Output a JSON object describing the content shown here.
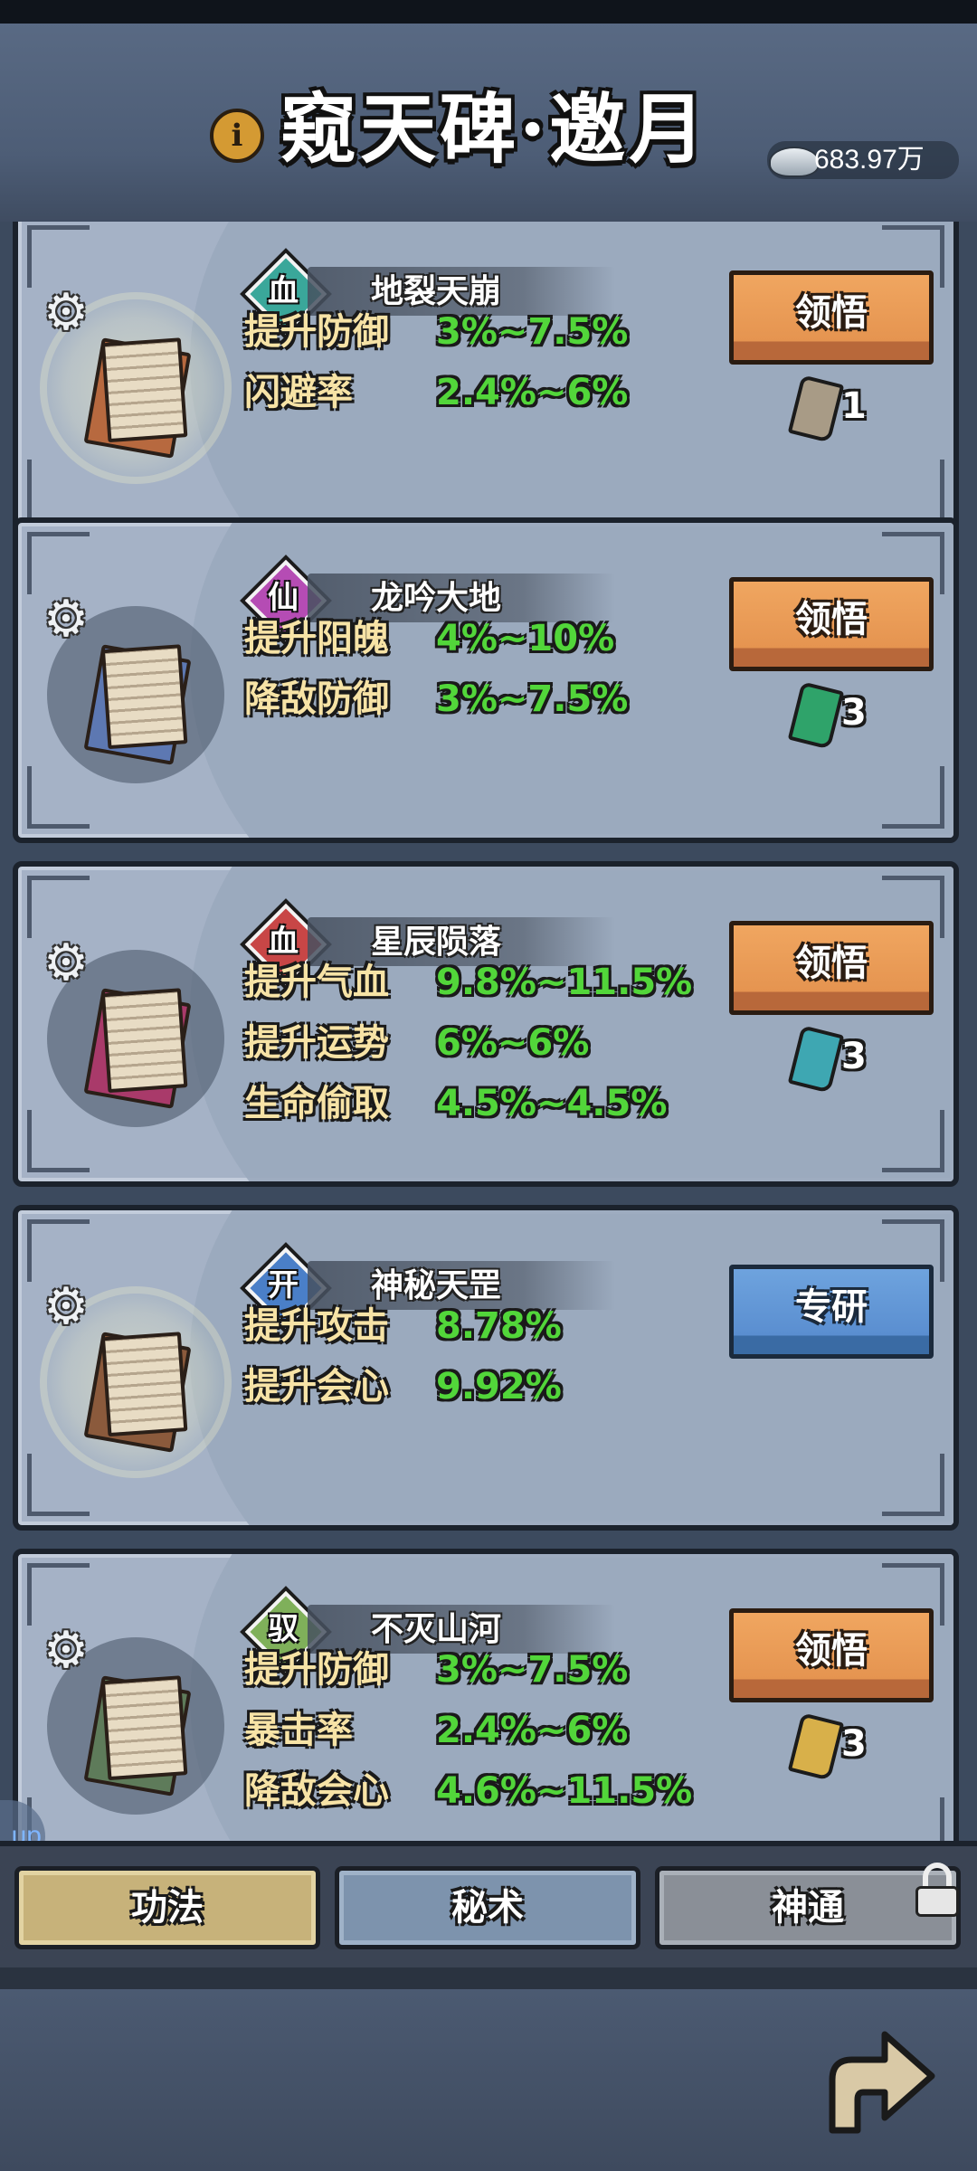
{
  "header": {
    "title": "窥天碑·邀月",
    "info_icon": "info-icon",
    "currency": {
      "icon": "silver-ingot-icon",
      "amount": "683.97万"
    }
  },
  "cards": [
    {
      "grade": "血",
      "grade_color": "#3aa79a",
      "name": "地裂天崩",
      "scroll_color": "#b7693f",
      "glow": true,
      "stats": [
        {
          "name": "提升防御",
          "value": "3%~7.5%"
        },
        {
          "name": "闪避率",
          "value": "2.4%~6%"
        }
      ],
      "button": {
        "label": "领悟",
        "style": "orange"
      },
      "cost": {
        "token_color": "#a89b86",
        "count": "1"
      }
    },
    {
      "grade": "仙",
      "grade_color": "#b54cb4",
      "name": "龙吟大地",
      "scroll_color": "#5d78b2",
      "glow": false,
      "stats": [
        {
          "name": "提升阳魄",
          "value": "4%~10%"
        },
        {
          "name": "降敌防御",
          "value": "3%~7.5%"
        }
      ],
      "button": {
        "label": "领悟",
        "style": "orange"
      },
      "cost": {
        "token_color": "#2fa36a",
        "count": "3"
      }
    },
    {
      "grade": "血",
      "grade_color": "#c84646",
      "name": "星辰陨落",
      "scroll_color": "#a93a6a",
      "glow": false,
      "stats": [
        {
          "name": "提升气血",
          "value": "9.8%~11.5%"
        },
        {
          "name": "提升运势",
          "value": "6%~6%"
        },
        {
          "name": "生命偷取",
          "value": "4.5%~4.5%"
        }
      ],
      "button": {
        "label": "领悟",
        "style": "orange"
      },
      "cost": {
        "token_color": "#3ea7b2",
        "count": "3"
      }
    },
    {
      "grade": "开",
      "grade_color": "#4a7fc8",
      "name": "神秘天罡",
      "scroll_color": "#8b5a3c",
      "glow": true,
      "stats": [
        {
          "name": "提升攻击",
          "value": "8.78%"
        },
        {
          "name": "提升会心",
          "value": "9.92%"
        }
      ],
      "button": {
        "label": "专研",
        "style": "blue"
      },
      "cost": null
    },
    {
      "grade": "驭",
      "grade_color": "#7fb05a",
      "name": "不灭山河",
      "scroll_color": "#5e7b5a",
      "glow": false,
      "stats": [
        {
          "name": "提升防御",
          "value": "3%~7.5%"
        },
        {
          "name": "暴击率",
          "value": "2.4%~6%"
        },
        {
          "name": "降敌会心",
          "value": "4.6%~11.5%"
        }
      ],
      "button": {
        "label": "领悟",
        "style": "orange"
      },
      "cost": {
        "token_color": "#d8b04a",
        "count": "3"
      }
    }
  ],
  "tabs": [
    {
      "label": "功法",
      "active": true
    },
    {
      "label": "秘术",
      "active": false
    },
    {
      "label": "神通",
      "active": false,
      "locked": true
    }
  ],
  "side_tab": "up",
  "footer": {
    "back_icon": "back-arrow-icon"
  }
}
